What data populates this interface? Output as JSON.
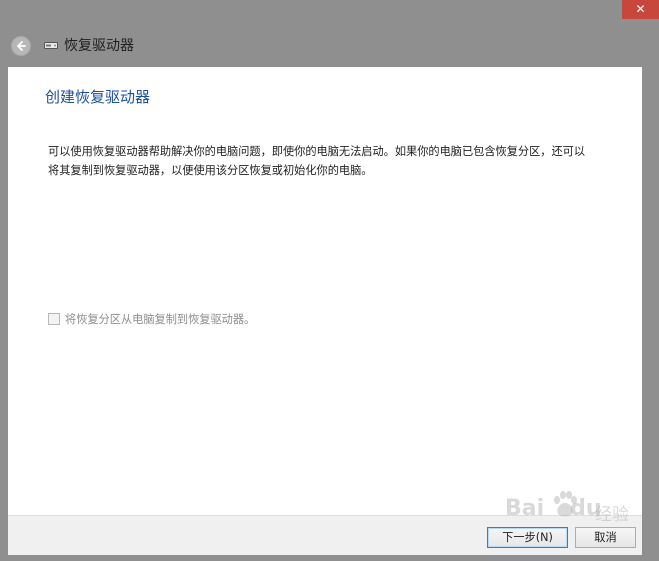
{
  "window": {
    "title": "恢复驱动器",
    "close_label": "✕",
    "icon": "drive-icon"
  },
  "header": {
    "back_icon": "back-arrow-icon"
  },
  "main": {
    "heading": "创建恢复驱动器",
    "description": "可以使用恢复驱动器帮助解决你的电脑问题，即使你的电脑无法启动。如果你的电脑已包含恢复分区，还可以将其复制到恢复驱动器，以便使用该分区恢复或初始化你的电脑。",
    "checkbox_label": "将恢复分区从电脑复制到恢复驱动器。",
    "checkbox_checked": false,
    "checkbox_enabled": false
  },
  "footer": {
    "next_label": "下一步(N)",
    "cancel_label": "取消"
  },
  "watermark": {
    "brand": "Bai",
    "brand_suffix": "du",
    "sub": "经验"
  },
  "colors": {
    "accent_heading": "#1d4f9c",
    "close_button": "#c7473d",
    "chrome": "#8f8f8f"
  }
}
